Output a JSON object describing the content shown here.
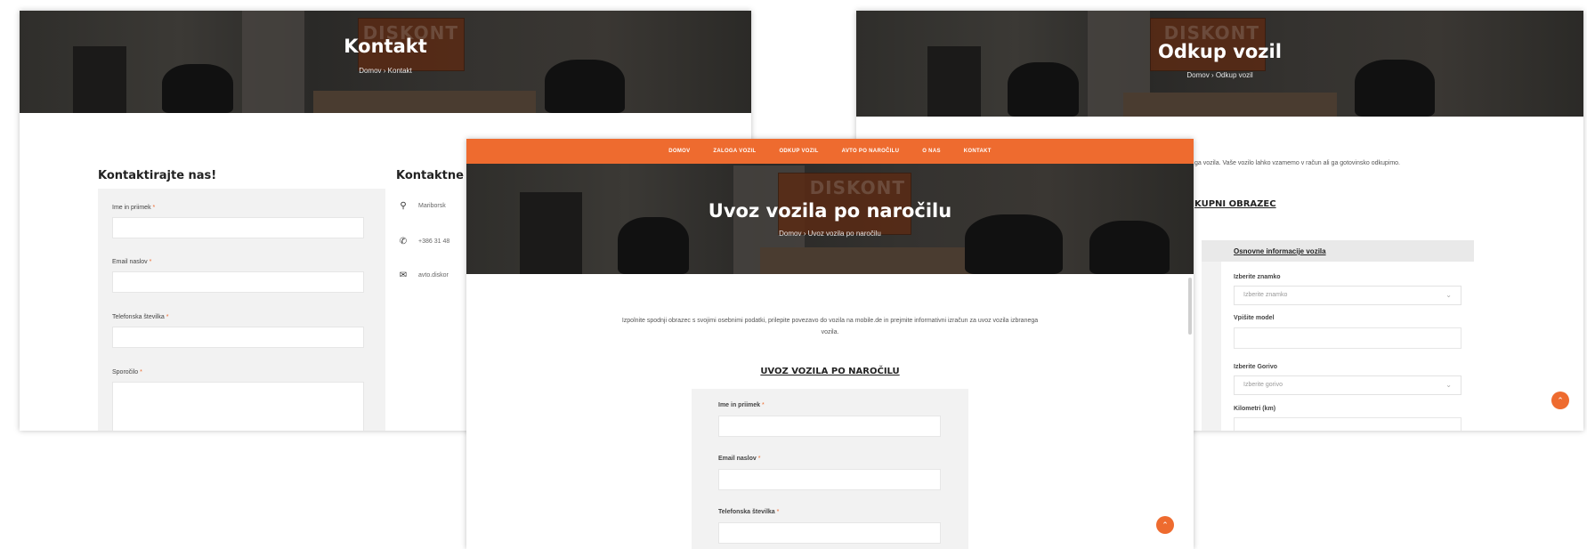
{
  "kontakt_page": {
    "hero_title": "Kontakt",
    "breadcrumb": "Domov  ›  Kontakt",
    "form_heading": "Kontaktirajte nas!",
    "info_heading": "Kontaktne",
    "fields": {
      "name_label": "Ime in priimek",
      "email_label": "Email naslov",
      "phone_label": "Telefonska številka",
      "message_label": "Sporočilo",
      "required_mark": "*"
    },
    "contact": {
      "address": "Mariborsk",
      "phone": "+386 31 48",
      "email": "avto.diskor"
    },
    "icons": {
      "address": "location-pin-icon",
      "phone": "phone-icon",
      "email": "envelope-icon"
    }
  },
  "odkup_page": {
    "hero_title": "Odkup vozil",
    "breadcrumb": "Domov  ›  Odkup vozil",
    "intro": "ga vozila. Vaše vozilo lahko vzamemo v račun ali ga gotovinsko odkupimo.",
    "form_heading": "KUPNI OBRAZEC",
    "section_tab": "Osnovne informacije vozila",
    "fields": {
      "brand_label": "Izberite znamko",
      "brand_placeholder": "Izberite znamko",
      "model_label": "Vpišite model",
      "fuel_label": "Izberite Gorivo",
      "fuel_placeholder": "Izberite gorivo",
      "km_label": "Kilometri (km)"
    }
  },
  "uvoz_page": {
    "nav": [
      "DOMOV",
      "ZALOGA VOZIL",
      "ODKUP VOZIL",
      "AVTO PO NAROČILU",
      "O NAS",
      "KONTAKT"
    ],
    "hero_title": "Uvoz vozila po naročilu",
    "breadcrumb": "Domov  ›  Uvoz vozila po naročilu",
    "intro_line1": "Izpolnite spodnji obrazec s svojimi osebnimi podatki, prilepite povezavo do vozila na mobile.de in prejmite informativni izračun za uvoz vozila izbranega",
    "intro_line2": "vozila.",
    "form_heading": "UVOZ VOZILA PO NAROČILU",
    "fields": {
      "name_label": "Ime in priimek",
      "email_label": "Email naslov",
      "phone_label": "Telefonska številka",
      "required_mark": "*"
    }
  },
  "hero_sign_text": "DISKONT",
  "colors": {
    "accent": "#ee6b2f",
    "form_bg": "#f2f2f2"
  }
}
